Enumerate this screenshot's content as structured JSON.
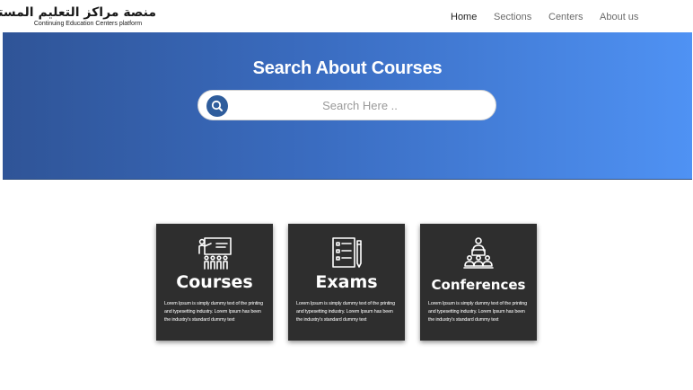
{
  "header": {
    "logo_arabic": "منصة مراكز التعليم المستمر",
    "logo_english": "Continuing Education Centers platform",
    "nav": [
      "Home",
      "Sections",
      "Centers",
      "About us"
    ]
  },
  "hero": {
    "title": "Search About Courses",
    "search_placeholder": "Search Here .."
  },
  "cards": [
    {
      "title": "Courses",
      "icon": "teacher-presentation-icon",
      "text": "Lorem Ipsum is simply dummy text of the printing and typesetting industry. Lorem Ipsum has been the industry's standard dummy text"
    },
    {
      "title": "Exams",
      "icon": "exam-sheet-icon",
      "text": "Lorem Ipsum is simply dummy text of the printing and typesetting industry. Lorem Ipsum has been the industry's standard dummy text"
    },
    {
      "title": "Conferences",
      "icon": "conference-speaker-icon",
      "text": "Lorem Ipsum is simply dummy text of the printing and typesetting industry. Lorem Ipsum has been the industry's standard dummy text"
    }
  ],
  "colors": {
    "hero_gradient_start": "#2f5497",
    "hero_gradient_end": "#4f92f4",
    "card_background": "#2e2e2e",
    "search_icon_background": "#2f5d9c"
  }
}
